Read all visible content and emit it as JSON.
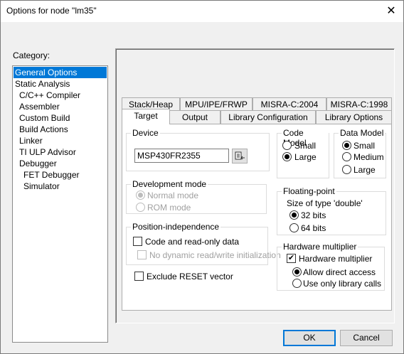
{
  "window": {
    "title": "Options for node \"lm35\""
  },
  "category": {
    "label": "Category:",
    "items": [
      {
        "label": "General Options",
        "selected": true
      },
      {
        "label": "Static Analysis"
      },
      {
        "label": "C/C++ Compiler"
      },
      {
        "label": "Assembler"
      },
      {
        "label": "Custom Build"
      },
      {
        "label": "Build Actions"
      },
      {
        "label": "Linker"
      },
      {
        "label": "TI ULP Advisor"
      },
      {
        "label": "Debugger"
      },
      {
        "label": "FET Debugger"
      },
      {
        "label": "Simulator"
      }
    ]
  },
  "tabs": {
    "row1": [
      "Stack/Heap",
      "MPU/IPE/FRWP",
      "MISRA-C:2004",
      "MISRA-C:1998"
    ],
    "row2": [
      "Target",
      "Output",
      "Library Configuration",
      "Library Options"
    ],
    "selected": "Target"
  },
  "device": {
    "label": "Device",
    "value": "MSP430FR2355"
  },
  "code_model": {
    "label": "Code Model",
    "options": [
      "Small",
      "Large"
    ],
    "selected": "Large"
  },
  "data_model": {
    "label": "Data Model",
    "options": [
      "Small",
      "Medium",
      "Large"
    ],
    "selected": "Small"
  },
  "dev_mode": {
    "label": "Development mode",
    "options": [
      "Normal mode",
      "ROM mode"
    ],
    "selected": "Normal mode"
  },
  "floating": {
    "label": "Floating-point",
    "sublabel": "Size of type 'double'",
    "options": [
      "32 bits",
      "64 bits"
    ],
    "selected": "32 bits"
  },
  "position": {
    "label": "Position-independence",
    "code_ro": "Code and read-only data",
    "no_dynamic": "No dynamic read/write initialization"
  },
  "exclude_reset": "Exclude RESET vector",
  "hw_mult": {
    "label": "Hardware multiplier",
    "checkbox": "Hardware multiplier",
    "options": [
      "Allow direct access",
      "Use only library calls"
    ],
    "selected": "Allow direct access"
  },
  "buttons": {
    "ok": "OK",
    "cancel": "Cancel"
  }
}
